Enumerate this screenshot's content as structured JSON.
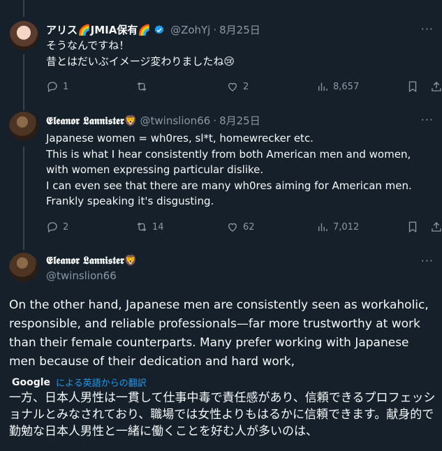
{
  "tweet1": {
    "name": "アリス🌈JMIA保有🌈",
    "handle": "@ZohYj",
    "sep": "·",
    "date": "8月25日",
    "text": "そうなんですね！\n昔とはだいぶイメージ変わりましたね😢",
    "replies": "1",
    "retweets": "",
    "likes": "2",
    "views": "8,657"
  },
  "tweet2": {
    "name": "𝕰𝖑𝖊𝖆𝖓𝖔𝖗 𝕷𝖆𝖓𝖓𝖎𝖘𝖙𝖊𝖗🦁",
    "handle": "@twinslion66",
    "sep": "·",
    "date": "8月25日",
    "text": "Japanese women = wh0res, sl*t, homewrecker etc.\nThis is what I hear consistently from both American men and women, with women expressing particular dislike.\nI can even see that there are many wh0res aiming for American men. Frankly speaking it's disgusting.",
    "replies": "2",
    "retweets": "14",
    "likes": "62",
    "views": "7,012"
  },
  "focus": {
    "name": "𝕰𝖑𝖊𝖆𝖓𝖔𝖗 𝕷𝖆𝖓𝖓𝖎𝖘𝖙𝖊𝖗🦁",
    "handle": "@twinslion66",
    "text": "On the other hand, Japanese men are consistently seen as workaholic, responsible, and reliable professionals—far more trustworthy at work than their female counterparts. Many prefer working with Japanese men because of their dedication and hard work,",
    "translate_brand": "Google",
    "translate_label": "による英語からの翻訳",
    "translation": "一方、日本人男性は一貫して仕事中毒で責任感があり、信頼できるプロフェッショナルとみなされており、職場では女性よりもはるかに信頼できます。献身的で勤勉な日本人男性と一緒に働くことを好む人が多いのは、"
  },
  "colors": {
    "background": "#15202b",
    "text": "#f7f9f9",
    "muted": "#8b98a5",
    "accent": "#1d9bf0",
    "divider": "#38444d"
  },
  "icons": [
    "verified-badge-icon",
    "reply-icon",
    "retweet-icon",
    "like-icon",
    "views-icon",
    "bookmark-icon",
    "share-icon",
    "more-icon"
  ]
}
